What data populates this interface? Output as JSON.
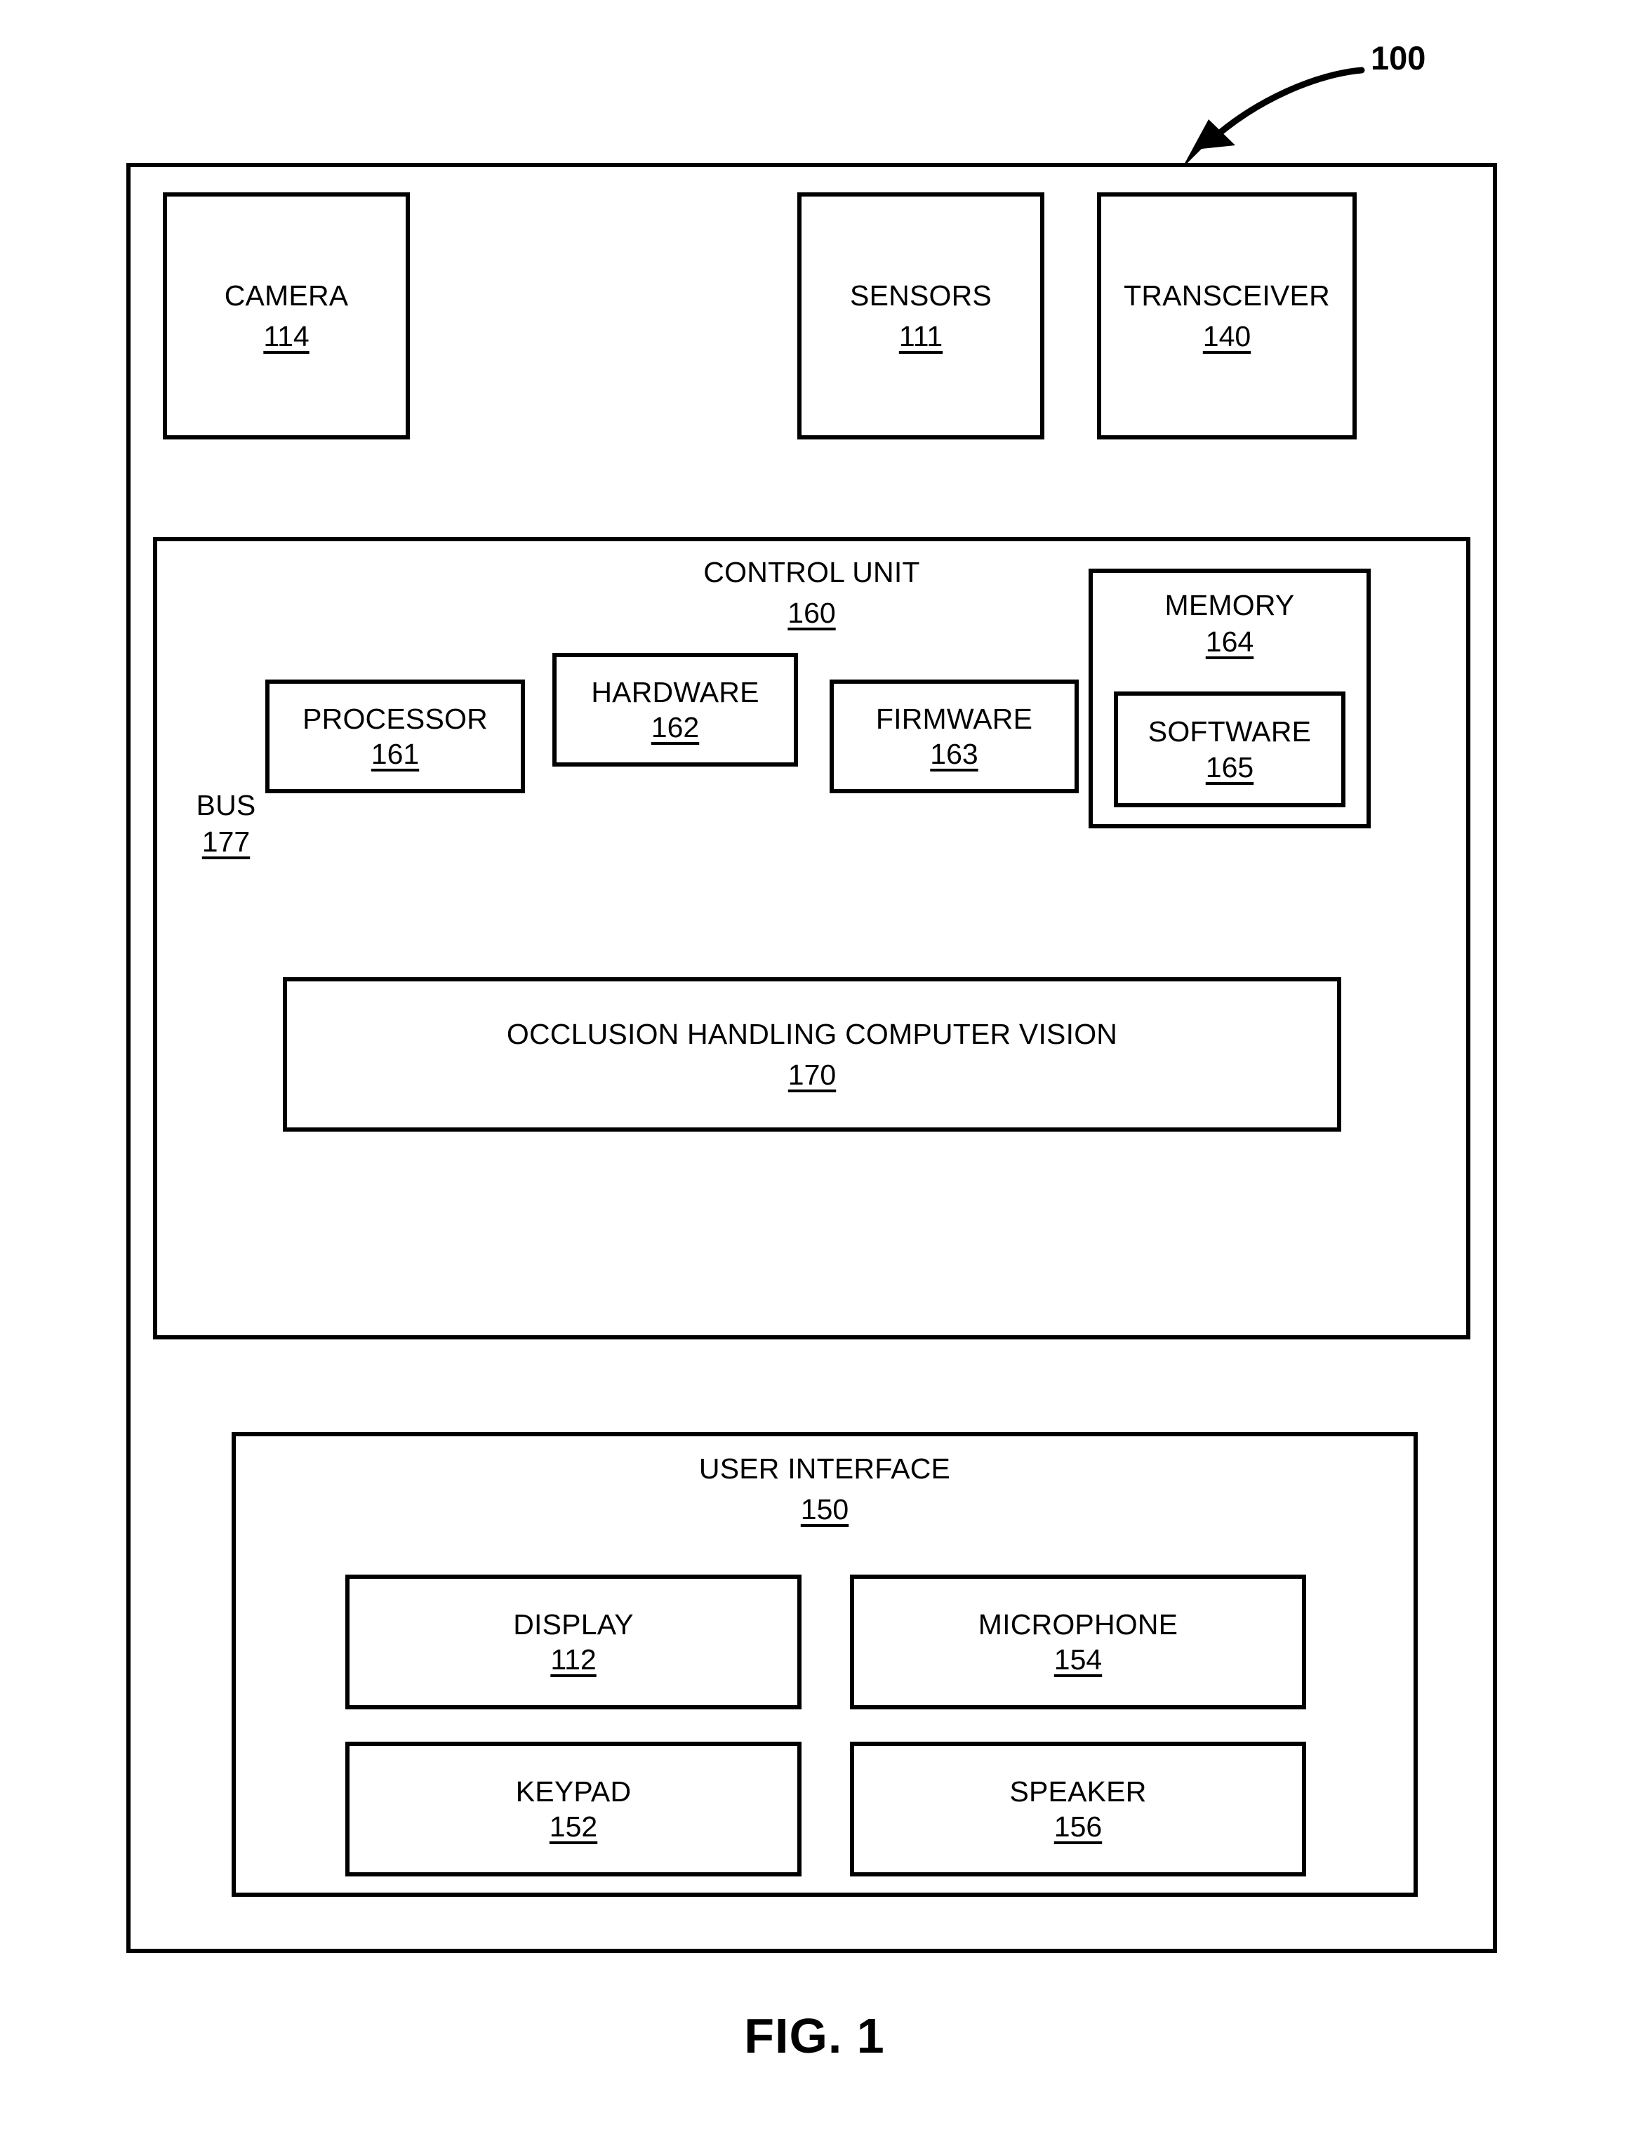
{
  "figure": {
    "reference_numeral": "100",
    "caption": "FIG. 1"
  },
  "outer_device": {
    "name": "device-frame"
  },
  "top_components": [
    {
      "label": "CAMERA",
      "number": "114"
    },
    {
      "label": "SENSORS",
      "number": "111"
    },
    {
      "label": "TRANSCEIVER",
      "number": "140"
    }
  ],
  "control_unit": {
    "label": "CONTROL UNIT",
    "number": "160",
    "bus": {
      "label": "BUS",
      "number": "177"
    },
    "components": [
      {
        "label": "PROCESSOR",
        "number": "161"
      },
      {
        "label": "HARDWARE",
        "number": "162"
      },
      {
        "label": "FIRMWARE",
        "number": "163"
      },
      {
        "label": "MEMORY",
        "number": "164"
      }
    ],
    "memory_inner": {
      "label": "SOFTWARE",
      "number": "165"
    },
    "module": {
      "label": "OCCLUSION HANDLING COMPUTER VISION",
      "number": "170"
    }
  },
  "user_interface": {
    "label": "USER INTERFACE",
    "number": "150",
    "components": [
      {
        "label": "DISPLAY",
        "number": "112"
      },
      {
        "label": "MICROPHONE",
        "number": "154"
      },
      {
        "label": "KEYPAD",
        "number": "152"
      },
      {
        "label": "SPEAKER",
        "number": "156"
      }
    ]
  },
  "colors": {
    "line": "#000000",
    "background": "#ffffff"
  }
}
